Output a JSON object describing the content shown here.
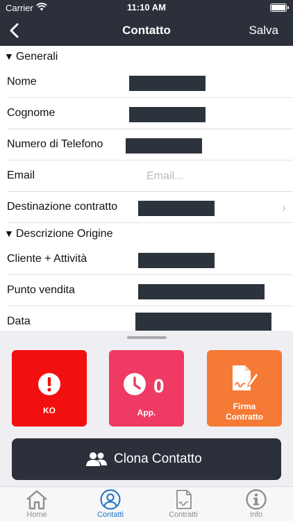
{
  "status_bar": {
    "carrier": "Carrier",
    "time": "11:10 AM"
  },
  "nav": {
    "title": "Contatto",
    "save_label": "Salva"
  },
  "sections": {
    "generali": "Generali",
    "origine": "Descrizione Origine"
  },
  "fields": {
    "nome": "Nome",
    "cognome": "Cognome",
    "telefono": "Numero di Telefono",
    "email": "Email",
    "email_placeholder": "Email...",
    "destinazione": "Destinazione contratto",
    "cliente": "Cliente + Attività",
    "punto_vendita": "Punto vendita",
    "data": "Data"
  },
  "actions": {
    "ko_label": "KO",
    "app_label": "App.",
    "app_count": "0",
    "firma_line1": "Firma",
    "firma_line2": "Contratto",
    "clone_label": "Clona Contatto"
  },
  "colors": {
    "header": "#2b303a",
    "ko": "#f20f0f",
    "app": "#ef3a63",
    "firma": "#f57a35",
    "active_tab": "#1a73c8"
  },
  "tabs": [
    {
      "label": "Home",
      "icon": "home-icon"
    },
    {
      "label": "Contatti",
      "icon": "user-circle-icon"
    },
    {
      "label": "Contratti",
      "icon": "contract-icon"
    },
    {
      "label": "Info",
      "icon": "info-icon"
    }
  ]
}
